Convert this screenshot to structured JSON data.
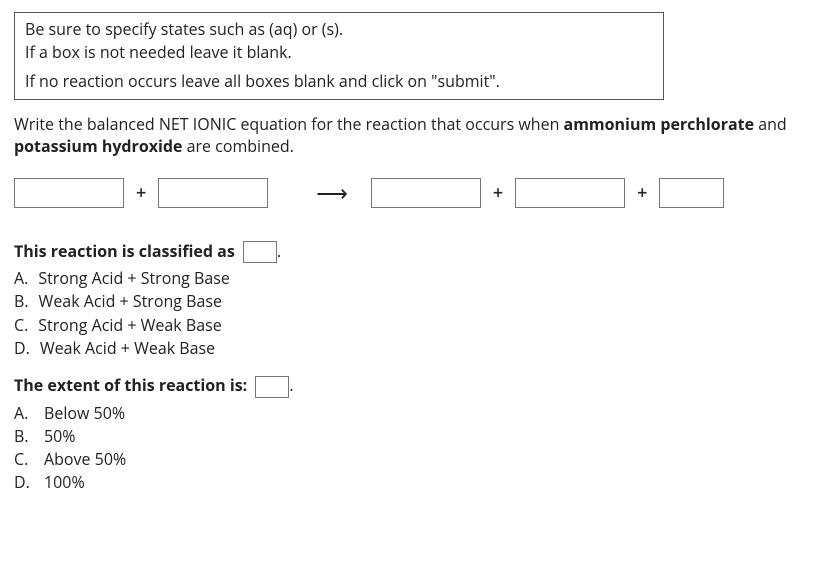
{
  "instructions": {
    "line1": "Be sure to specify states such as (aq) or (s).",
    "line2": "If a box is not needed leave it blank.",
    "line3": "If no reaction occurs leave all boxes blank and click on \"submit\"."
  },
  "prompt": {
    "prefix": "Write the balanced NET IONIC equation for the reaction that occurs when ",
    "bold1": "ammonium perchlorate",
    "mid": " and ",
    "bold2": "potassium hydroxide",
    "suffix": " are combined."
  },
  "equation": {
    "reactant1": "",
    "reactant2": "",
    "product1": "",
    "product2": "",
    "product3": "",
    "plus": "+",
    "arrow": "⟶"
  },
  "classification": {
    "label": "This reaction is classified as",
    "value": "",
    "period": ".",
    "options": [
      {
        "letter": "A.",
        "text": "Strong Acid + Strong Base"
      },
      {
        "letter": "B.",
        "text": "Weak Acid + Strong Base"
      },
      {
        "letter": "C.",
        "text": "Strong Acid + Weak Base"
      },
      {
        "letter": "D.",
        "text": "Weak Acid + Weak Base"
      }
    ]
  },
  "extent": {
    "label": "The extent of this reaction is:",
    "value": "",
    "period": ".",
    "options": [
      {
        "letter": "A.",
        "text": "Below 50%"
      },
      {
        "letter": "B.",
        "text": "50%"
      },
      {
        "letter": "C.",
        "text": "Above 50%"
      },
      {
        "letter": "D.",
        "text": "100%"
      }
    ]
  }
}
